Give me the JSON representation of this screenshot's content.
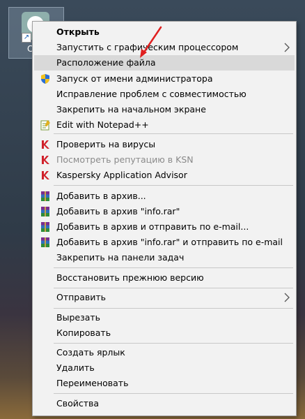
{
  "desktop": {
    "icon_caption": "C"
  },
  "menu": {
    "items": [
      {
        "label": "Открыть"
      },
      {
        "label": "Запустить с графическим процессором"
      },
      {
        "label": "Расположение файла"
      },
      {
        "label": "Запуск от имени администратора"
      },
      {
        "label": "Исправление проблем с совместимостью"
      },
      {
        "label": "Закрепить на начальном экране"
      },
      {
        "label": "Edit with Notepad++"
      },
      {
        "label": "Проверить на вирусы"
      },
      {
        "label": "Посмотреть репутацию в KSN"
      },
      {
        "label": "Kaspersky Application Advisor"
      },
      {
        "label": "Добавить в архив..."
      },
      {
        "label": "Добавить в архив \"info.rar\""
      },
      {
        "label": "Добавить в архив и отправить по e-mail..."
      },
      {
        "label": "Добавить в архив \"info.rar\" и отправить по e-mail"
      },
      {
        "label": "Закрепить на панели задач"
      },
      {
        "label": "Восстановить прежнюю версию"
      },
      {
        "label": "Отправить"
      },
      {
        "label": "Вырезать"
      },
      {
        "label": "Копировать"
      },
      {
        "label": "Создать ярлык"
      },
      {
        "label": "Удалить"
      },
      {
        "label": "Переименовать"
      },
      {
        "label": "Свойства"
      }
    ]
  },
  "colors": {
    "menu_bg": "#f2f2f2",
    "highlight_bg": "#d9d9d9",
    "disabled_text": "#8a8a8a",
    "annotation_arrow": "#e02020",
    "kaspersky_red": "#d0202a"
  }
}
